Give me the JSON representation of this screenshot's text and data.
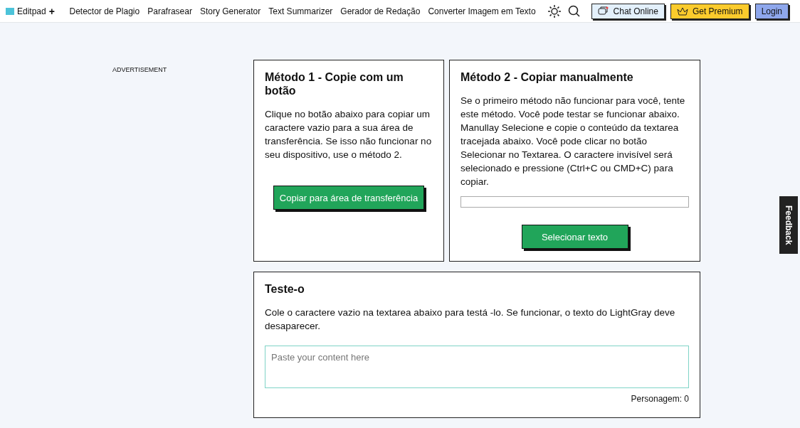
{
  "header": {
    "logo": "Editpad",
    "logo_plus": "+",
    "nav": [
      "Detector de Plagio",
      "Parafrasear",
      "Story Generator",
      "Text Summarizer",
      "Gerador de Redação",
      "Converter Imagem em Texto"
    ],
    "buttons": [
      {
        "kind": "chat",
        "label": "Chat Online"
      },
      {
        "kind": "premium",
        "label": "Get Premium"
      },
      {
        "kind": "login",
        "label": "Login"
      }
    ]
  },
  "sidebar": {
    "ad_label": "ADVERTISEMENT"
  },
  "method_1": {
    "title": "Método 1 - Copie com um botão",
    "text": "Clique no botão abaixo para copiar um caractere vazio para a sua área de transferência. Se isso não funcionar no seu dispositivo, use o método 2.",
    "button": "Copiar para área de transferência"
  },
  "method_2": {
    "title": "Método 2 - Copiar manualmente",
    "text": "Se o primeiro método não funcionar para você, tente este método. Você pode testar se funcionar abaixo. Manullay Selecione e copie o conteúdo da textarea tracejada abaixo. Você pode clicar no botão Selecionar no Textarea. O caractere invisível será selecionado e pressione (Ctrl+C ou CMD+C) para copiar.",
    "button": "Selecionar texto"
  },
  "test": {
    "title": "Teste-o",
    "text": "Cole o caractere vazio na textarea abaixo para testá -lo. Se funcionar, o texto do LightGray deve desaparecer.",
    "placeholder": "Paste your content here",
    "counter": "Personagem: 0"
  },
  "feedback_tab": "Feedback"
}
